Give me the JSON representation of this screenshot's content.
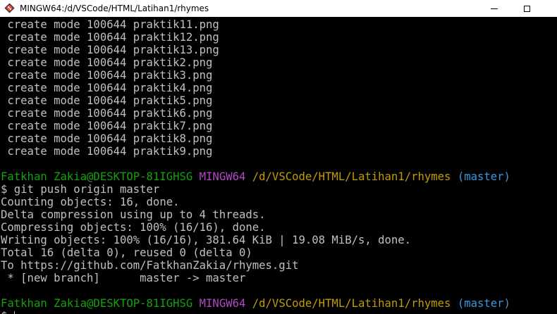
{
  "window": {
    "title": "MINGW64:/d/VSCode/HTML/Latihan1/rhymes",
    "icon": "git-bash-icon",
    "controls": [
      "minimize",
      "maximize"
    ]
  },
  "colors": {
    "background": "#000000",
    "text": "#c0c0c0",
    "user_host": "#13a10e",
    "msystem": "#b148c6",
    "path": "#c19c00",
    "branch": "#3a96dd"
  },
  "terminal": {
    "create_lines": [
      " create mode 100644 praktik11.png",
      " create mode 100644 praktik12.png",
      " create mode 100644 praktik13.png",
      " create mode 100644 praktik2.png",
      " create mode 100644 praktik3.png",
      " create mode 100644 praktik4.png",
      " create mode 100644 praktik5.png",
      " create mode 100644 praktik6.png",
      " create mode 100644 praktik7.png",
      " create mode 100644 praktik8.png",
      " create mode 100644 praktik9.png"
    ],
    "prompt1": {
      "user": "Fatkhan Zakia@DESKTOP-81IGHSG",
      "msystem": "MINGW64",
      "path": "/d/VSCode/HTML/Latihan1/rhymes",
      "branch": "(master)"
    },
    "command": "$ git push origin master",
    "output": [
      "Counting objects: 16, done.",
      "Delta compression using up to 4 threads.",
      "Compressing objects: 100% (16/16), done.",
      "Writing objects: 100% (16/16), 381.64 KiB | 19.08 MiB/s, done.",
      "Total 16 (delta 0), reused 0 (delta 0)",
      "To https://github.com/FatkhanZakia/rhymes.git",
      " * [new branch]      master -> master"
    ],
    "prompt2": {
      "user": "Fatkhan Zakia@DESKTOP-81IGHSG",
      "msystem": "MINGW64",
      "path": "/d/VSCode/HTML/Latihan1/rhymes",
      "branch": "(master)"
    },
    "input_prompt": "$ "
  }
}
